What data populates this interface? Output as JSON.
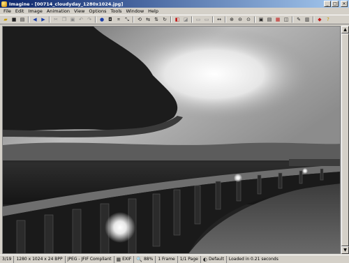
{
  "window": {
    "title": "Imagine - [00714_cloudyday_1280x1024.jpg]",
    "minimize": "_",
    "maximize": "□",
    "close": "×",
    "colors": {
      "titlebar_start": "#0a246a",
      "titlebar_end": "#a6caf0",
      "face": "#d4d0c8"
    }
  },
  "menu": [
    "File",
    "Edit",
    "Image",
    "Animation",
    "View",
    "Options",
    "Tools",
    "Window",
    "Help"
  ],
  "toolbar": [
    {
      "name": "open-folder-icon",
      "glyph": "▰",
      "color": "g-yellow"
    },
    {
      "name": "save-icon",
      "glyph": "■",
      "color": "g-dark"
    },
    {
      "name": "print-icon",
      "glyph": "▤",
      "color": "g-dark"
    },
    {
      "name": "sep"
    },
    {
      "name": "back-arrow-icon",
      "glyph": "◀",
      "color": "g-blue"
    },
    {
      "name": "forward-arrow-icon",
      "glyph": "▶",
      "color": "g-blue"
    },
    {
      "name": "sep"
    },
    {
      "name": "cut-icon",
      "glyph": "✂",
      "color": "g-gray"
    },
    {
      "name": "copy-icon",
      "glyph": "❐",
      "color": "g-gray"
    },
    {
      "name": "paste-icon",
      "glyph": "▣",
      "color": "g-gray"
    },
    {
      "name": "undo-icon",
      "glyph": "↶",
      "color": "g-gray"
    },
    {
      "name": "redo-icon",
      "glyph": "↷",
      "color": "g-gray"
    },
    {
      "name": "sep"
    },
    {
      "name": "info-icon",
      "glyph": "●",
      "color": "g-blue"
    },
    {
      "name": "capture-icon",
      "glyph": "◘",
      "color": "g-dark"
    },
    {
      "name": "crop-icon",
      "glyph": "⌗",
      "color": "g-dark"
    },
    {
      "name": "resize-icon",
      "glyph": "⤡",
      "color": "g-dark"
    },
    {
      "name": "sep"
    },
    {
      "name": "rotate-left-icon",
      "glyph": "⟲",
      "color": "g-dark"
    },
    {
      "name": "flip-icon",
      "glyph": "⇆",
      "color": "g-dark"
    },
    {
      "name": "mirror-icon",
      "glyph": "⇅",
      "color": "g-dark"
    },
    {
      "name": "rotate-icon",
      "glyph": "↻",
      "color": "g-dark"
    },
    {
      "name": "sep"
    },
    {
      "name": "effects-icon",
      "glyph": "◧",
      "color": "g-red"
    },
    {
      "name": "color-icon",
      "glyph": "◪",
      "color": "g-gray"
    },
    {
      "name": "sep"
    },
    {
      "name": "copy-to-icon",
      "glyph": "▭",
      "color": "g-gray"
    },
    {
      "name": "move-to-icon",
      "glyph": "▭",
      "color": "g-gray"
    },
    {
      "name": "sep"
    },
    {
      "name": "rename-icon",
      "glyph": "↔",
      "color": "g-dark"
    },
    {
      "name": "sep"
    },
    {
      "name": "zoom-in-icon",
      "glyph": "⊕",
      "color": "g-dark"
    },
    {
      "name": "zoom-out-icon",
      "glyph": "⊖",
      "color": "g-dark"
    },
    {
      "name": "zoom-fit-icon",
      "glyph": "⊙",
      "color": "g-dark"
    },
    {
      "name": "sep"
    },
    {
      "name": "fullscreen-icon",
      "glyph": "▣",
      "color": "g-dark"
    },
    {
      "name": "slideshow-icon",
      "glyph": "▤",
      "color": "g-dark"
    },
    {
      "name": "thumbnails-icon",
      "glyph": "▦",
      "color": "g-red"
    },
    {
      "name": "compare-icon",
      "glyph": "◫",
      "color": "g-dark"
    },
    {
      "name": "sep"
    },
    {
      "name": "settings-icon",
      "glyph": "✎",
      "color": "g-dark"
    },
    {
      "name": "plugins-icon",
      "glyph": "▥",
      "color": "g-dark"
    },
    {
      "name": "sep"
    },
    {
      "name": "book-icon",
      "glyph": "◆",
      "color": "g-red"
    },
    {
      "name": "help-icon",
      "glyph": "?",
      "color": "g-yellow"
    }
  ],
  "status": {
    "index": "3/19",
    "dimensions": "1280 x 1024 x 24 BPP",
    "format": "JPEG - JFIF Compliant",
    "exif": "EXIF",
    "zoom": "88%",
    "frames": "1 Frame",
    "pages": "1/1 Page",
    "profile": "Default",
    "load_time": "Loaded in 0.21 seconds"
  }
}
